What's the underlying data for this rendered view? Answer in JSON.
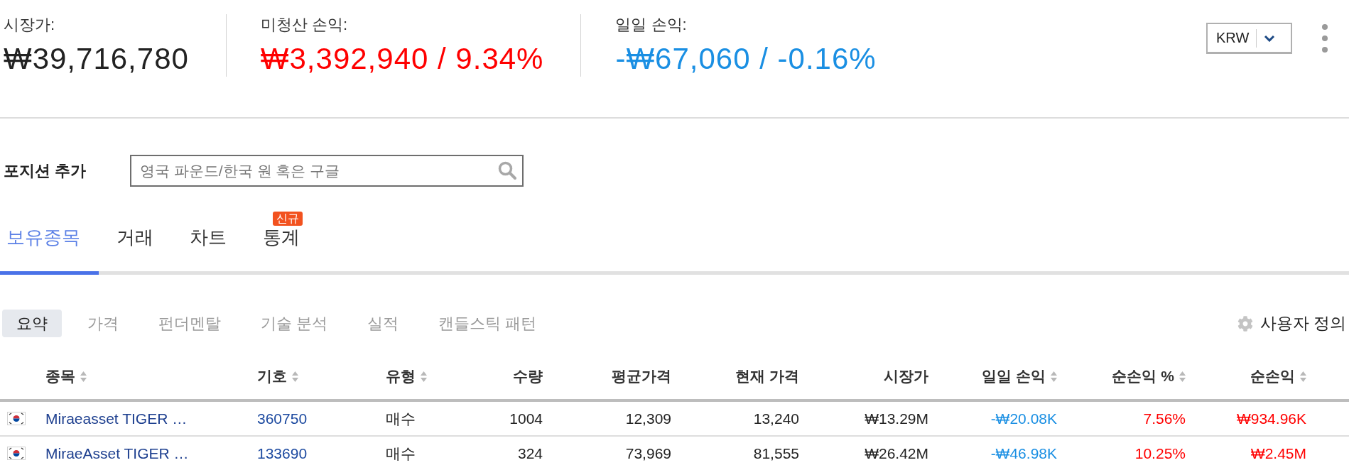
{
  "summary": [
    {
      "label": "시장가:",
      "value": "₩39,716,780",
      "color": "#222222"
    },
    {
      "label": "미청산 손익:",
      "value": "₩3,392,940 / 9.34%",
      "color": "#ff0000"
    },
    {
      "label": "일일 손익:",
      "value": "-₩67,060 / -0.16%",
      "color": "#1a8fe3"
    }
  ],
  "currency_select": {
    "value": "KRW"
  },
  "add_position": {
    "label": "포지션 추가",
    "placeholder": "영국 파운드/한국 원 혹은 구글"
  },
  "tabs": [
    {
      "label": "보유종목",
      "selected": true
    },
    {
      "label": "거래",
      "selected": false
    },
    {
      "label": "차트",
      "selected": false
    },
    {
      "label": "통계",
      "selected": false,
      "badge": "신규"
    }
  ],
  "sub_tabs": [
    {
      "label": "요약",
      "selected": true
    },
    {
      "label": "가격",
      "selected": false
    },
    {
      "label": "펀더멘탈",
      "selected": false
    },
    {
      "label": "기술 분석",
      "selected": false
    },
    {
      "label": "실적",
      "selected": false
    },
    {
      "label": "캔들스틱 패턴",
      "selected": false
    }
  ],
  "customize_button": {
    "label": "사용자 정의"
  },
  "table": {
    "columns": [
      {
        "label": "종목",
        "sortable": true
      },
      {
        "label": "기호",
        "sortable": true
      },
      {
        "label": "유형",
        "sortable": true
      },
      {
        "label": "수량",
        "sortable": false
      },
      {
        "label": "평균가격",
        "sortable": false
      },
      {
        "label": "현재 가격",
        "sortable": false
      },
      {
        "label": "시장가",
        "sortable": false
      },
      {
        "label": "일일 손익",
        "sortable": true
      },
      {
        "label": "순손익 %",
        "sortable": true
      },
      {
        "label": "순손익",
        "sortable": true
      }
    ],
    "rows": [
      {
        "name": "Miraeasset TIGER …",
        "symbol": "360750",
        "type": "매수",
        "quantity": "1004",
        "avg_price": "12,309",
        "price": "13,240",
        "market_value": "₩13.29M",
        "daily_pl": {
          "text": "-₩20.08K",
          "color": "#1a8fe3"
        },
        "net_pl_pct": {
          "text": "7.56%",
          "color": "#ff0000"
        },
        "net_pl": {
          "text": "₩934.96K",
          "color": "#ff0000"
        }
      },
      {
        "name": "MiraeAsset TIGER …",
        "symbol": "133690",
        "type": "매수",
        "quantity": "324",
        "avg_price": "73,969",
        "price": "81,555",
        "market_value": "₩26.42M",
        "daily_pl": {
          "text": "-₩46.98K",
          "color": "#1a8fe3"
        },
        "net_pl_pct": {
          "text": "10.25%",
          "color": "#ff0000"
        },
        "net_pl": {
          "text": "₩2.45M",
          "color": "#ff0000"
        }
      }
    ]
  }
}
